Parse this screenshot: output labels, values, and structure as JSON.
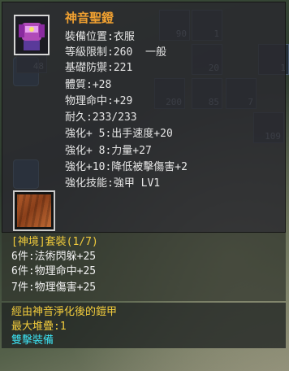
{
  "item": {
    "name": "神音聖鐙",
    "stats": [
      "裝備位置:衣服",
      "等級限制:260  一般",
      "基礎防禦:221",
      "體質:+28",
      "物理命中:+29",
      "耐久:233/233",
      "強化+ 5:出手速度+20",
      "強化+ 8:力量+27",
      "強化+10:降低被擊傷害+2",
      "強化技能:強甲 LV1"
    ]
  },
  "set": {
    "header": "[神境]套裝(1/7)",
    "bonuses": [
      "6件:法術閃躲+25",
      "6件:物理命中+25",
      "7件:物理傷害+25"
    ]
  },
  "description": {
    "text": "經由神音淨化後的鎧甲",
    "stack": "最大堆疊:1",
    "tag": "雙擊裝備"
  },
  "background": {
    "counts": [
      "90",
      "1",
      "48",
      "20",
      "1",
      "200",
      "85",
      "7",
      "109"
    ]
  },
  "colors": {
    "title": "#f0a030",
    "stat": "#e6e6e6",
    "set": "#f2cc3c",
    "tag": "#3ce0f0"
  }
}
